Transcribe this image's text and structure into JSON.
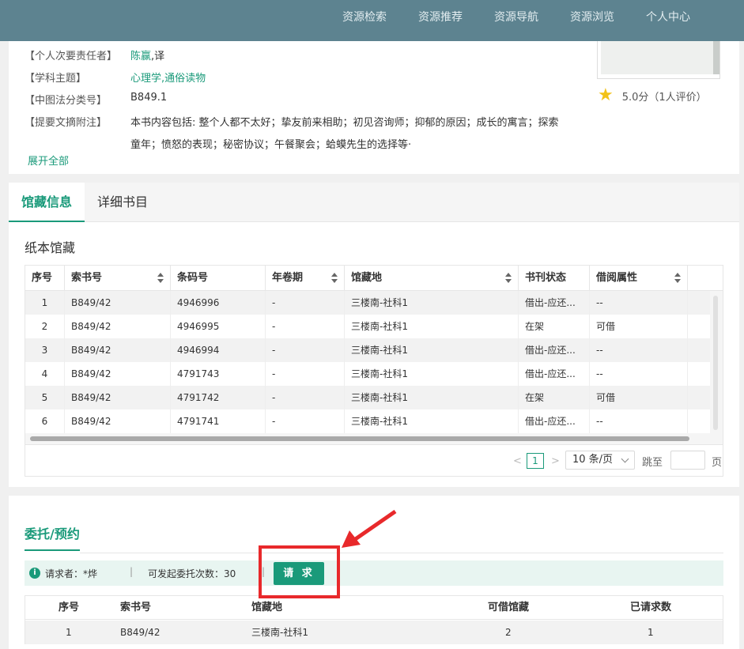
{
  "nav": {
    "items": [
      "资源检索",
      "资源推荐",
      "资源导航",
      "资源浏览",
      "个人中心"
    ]
  },
  "meta": {
    "responsible": {
      "key": "【个人次要责任者】",
      "name": "陈赢",
      "suffix": ",译"
    },
    "subject": {
      "key": "【学科主题】",
      "link1": "心理学",
      "sep": ",",
      "link2": "通俗读物"
    },
    "classno": {
      "key": "【中图法分类号】",
      "value": "B849.1"
    },
    "abstract": {
      "key": "【提要文摘附注】",
      "line1": "本书内容包括: 整个人都不太好；挚友前来相助；初见咨询师；抑郁的原因；成长的寓言；探索",
      "line2": "童年；愤怒的表现；秘密协议；午餐聚会；蛤蟆先生的选择等·"
    },
    "expand_all": "展开全部"
  },
  "rating": {
    "icon": "star-icon",
    "text": "5.0分（1人评价）"
  },
  "holding": {
    "tabs": [
      "馆藏信息",
      "详细书目"
    ],
    "section_title": "纸本馆藏",
    "columns": [
      "序号",
      "索书号",
      "条码号",
      "年卷期",
      "馆藏地",
      "书刊状态",
      "借阅属性"
    ],
    "rows": [
      [
        "1",
        "B849/42",
        "4946996",
        "-",
        "三楼南-社科1",
        "借出-应还...",
        "--"
      ],
      [
        "2",
        "B849/42",
        "4946995",
        "-",
        "三楼南-社科1",
        "在架",
        "可借"
      ],
      [
        "3",
        "B849/42",
        "4946994",
        "-",
        "三楼南-社科1",
        "借出-应还...",
        "--"
      ],
      [
        "4",
        "B849/42",
        "4791743",
        "-",
        "三楼南-社科1",
        "借出-应还...",
        "--"
      ],
      [
        "5",
        "B849/42",
        "4791742",
        "-",
        "三楼南-社科1",
        "在架",
        "可借"
      ],
      [
        "6",
        "B849/42",
        "4791741",
        "-",
        "三楼南-社科1",
        "借出-应还...",
        "--"
      ]
    ],
    "pager": {
      "prev": "<",
      "page": "1",
      "next": ">",
      "page_size": "10 条/页",
      "goto": "跳至",
      "page_suffix": "页"
    }
  },
  "entrust": {
    "title": "委托/预约",
    "info_icon": "i",
    "requester": "请求者：*烨",
    "sep": "|",
    "remaining": "可发起委托次数：30",
    "request_button": "请 求",
    "columns": [
      "序号",
      "索书号",
      "馆藏地",
      "可借馆藏",
      "已请求数"
    ],
    "row": [
      "1",
      "B849/42",
      "三楼南-社科1",
      "2",
      "1"
    ]
  },
  "annotation": {
    "color": "#e8292b"
  }
}
